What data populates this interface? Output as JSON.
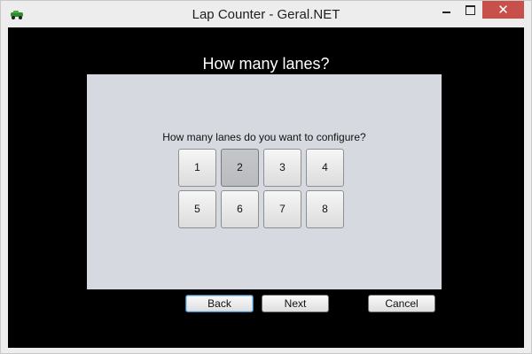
{
  "window": {
    "title": "Lap Counter - Geral.NET",
    "close_glyph": "✕"
  },
  "page": {
    "heading": "How many lanes?",
    "question": "How many lanes do you want to configure?"
  },
  "lanes": {
    "options": [
      "1",
      "2",
      "3",
      "4",
      "5",
      "6",
      "7",
      "8"
    ],
    "selected": "2"
  },
  "buttons": {
    "back": "Back",
    "next": "Next",
    "cancel": "Cancel"
  },
  "colors": {
    "background": "#000000",
    "panel": "#d6d9e0",
    "close_button": "#c7504b"
  }
}
